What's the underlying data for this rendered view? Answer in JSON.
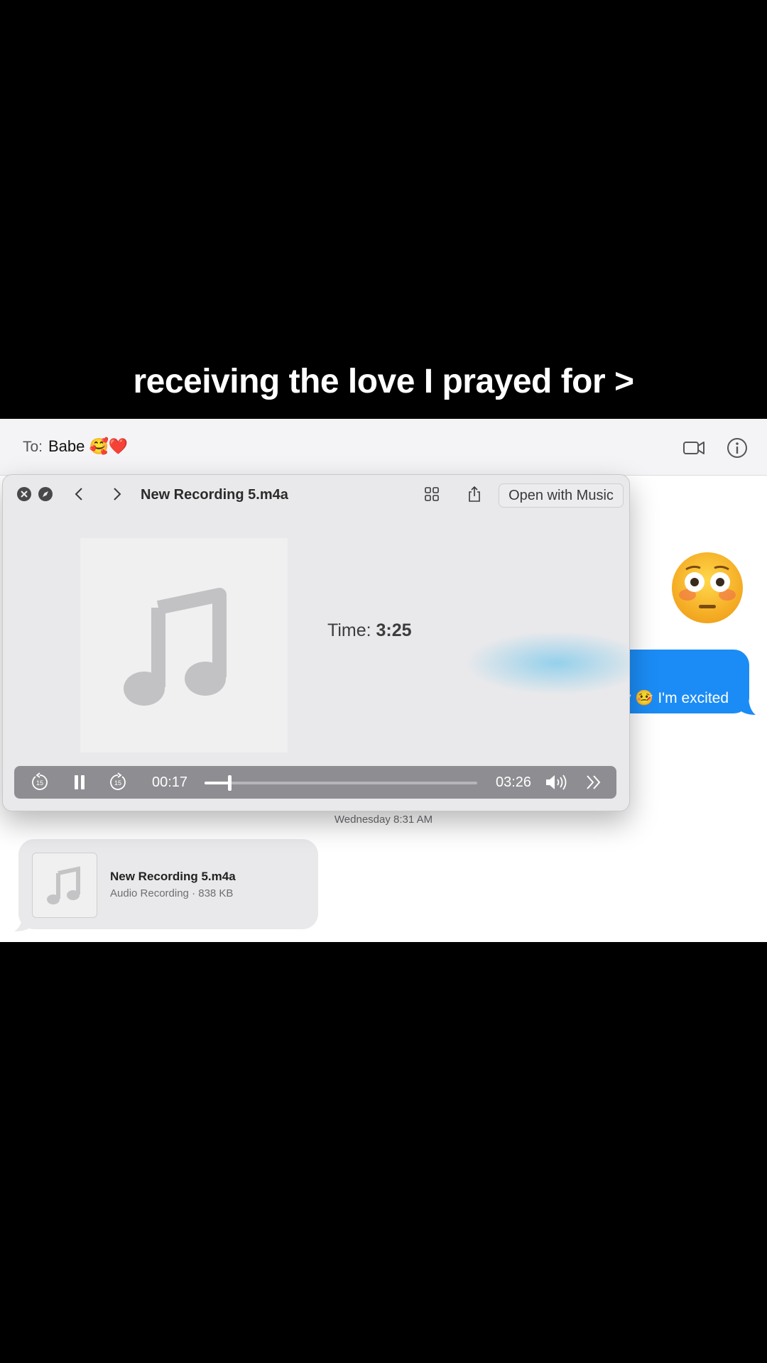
{
  "caption": "receiving the love I prayed for >",
  "conversation": {
    "to_label": "To:",
    "recipient": "Babe 🥰❤️",
    "timestamp": "Wednesday 8:31 AM",
    "sent_message_partial": "y 🤒 I'm excited",
    "attachment": {
      "name": "New Recording 5.m4a",
      "meta": "Audio Recording · 838 KB"
    }
  },
  "quicklook": {
    "title": "New Recording 5.m4a",
    "open_button": "Open with Music",
    "time_label": "Time:",
    "time_value": "3:25",
    "elapsed": "00:17",
    "remaining": "03:26",
    "progress": 0.09
  },
  "colors": {
    "bubble_blue": "#1b8cf5",
    "controls_bg": "#8e8e92"
  },
  "icons": [
    "close-icon",
    "compass-icon",
    "chevron-left-icon",
    "chevron-right-icon",
    "grid-icon",
    "share-icon",
    "video-icon",
    "info-icon",
    "skip-back-15-icon",
    "pause-icon",
    "skip-forward-15-icon",
    "volume-icon",
    "fast-forward-icon",
    "music-note-icon",
    "flushed-face-emoji"
  ]
}
